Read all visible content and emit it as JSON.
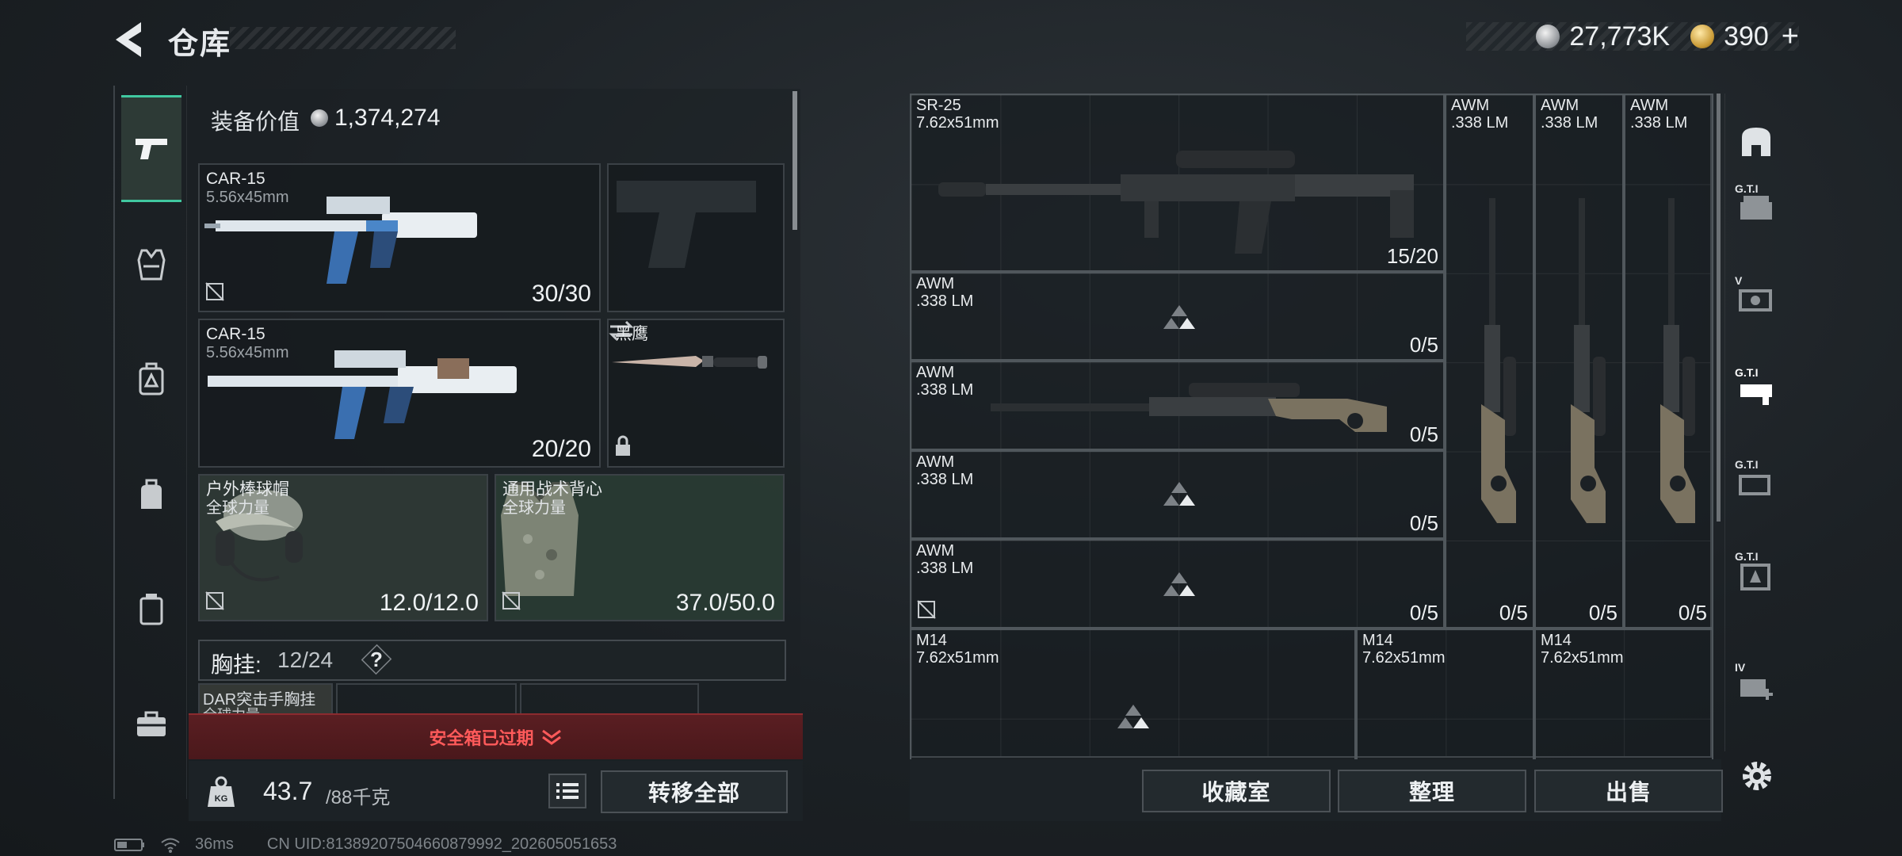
{
  "header": {
    "title": "仓库"
  },
  "currency": {
    "silver": "27,773K",
    "gold": "390",
    "gold_plus": "+"
  },
  "loadout": {
    "equip_value_label": "装备价值",
    "equip_value": "1,374,274",
    "slots": [
      {
        "name": "CAR-15",
        "caliber": "5.56x45mm",
        "count": "30/30"
      },
      {
        "name": "CAR-15",
        "caliber": "5.56x45mm",
        "count": "20/20"
      },
      {
        "name": "黑鹰"
      },
      {
        "name": "户外棒球帽",
        "brand": "全球力量",
        "count": "12.0/12.0"
      },
      {
        "name": "通用战术背心",
        "brand": "全球力量",
        "count": "37.0/50.0"
      }
    ],
    "chest_rig_label": "胸挂:",
    "chest_rig_value": "12/24",
    "chest_rig_help": "?",
    "rig_item_name": "DAR突击手胸挂",
    "rig_item_brand": "全球力量"
  },
  "safe_box": {
    "expired": "安全箱已过期"
  },
  "weight": {
    "current": "43.7",
    "max": "/88千克"
  },
  "buttons": {
    "transfer_all": "转移全部",
    "collection": "收藏室",
    "organize": "整理",
    "sell": "出售"
  },
  "storage": {
    "items": [
      {
        "name": "SR-25",
        "caliber": "7.62x51mm",
        "count": "15/20"
      },
      {
        "name": "AWM",
        "caliber": ".338 LM",
        "count": "0/5"
      },
      {
        "name": "AWM",
        "caliber": ".338 LM",
        "count": "0/5"
      },
      {
        "name": "AWM",
        "caliber": ".338 LM",
        "count": "0/5"
      },
      {
        "name": "AWM",
        "caliber": ".338 LM",
        "count": "0/5"
      },
      {
        "name": "AWM",
        "caliber": ".338 LM",
        "count": "0/5"
      },
      {
        "name": "AWM",
        "caliber": ".338 LM",
        "count": "0/5"
      },
      {
        "name": "AWM",
        "caliber": ".338 LM",
        "count": "0/5"
      },
      {
        "name": "M14",
        "caliber": "7.62x51mm"
      },
      {
        "name": "M14",
        "caliber": "7.62x51mm"
      },
      {
        "name": "M14",
        "caliber": "7.62x51mm"
      }
    ]
  },
  "right_rail": {
    "labels": [
      "G.T.I",
      "V",
      "G.T.I",
      "G.T.I",
      "G.T.I",
      "IV"
    ]
  },
  "status": {
    "ping": "36ms",
    "uid": "CN UID:81389207504660879992_202605051653"
  },
  "colors": {
    "accent": "#40c8a0",
    "alert": "#ff5a5a",
    "alert_bg": "#4a181b"
  }
}
